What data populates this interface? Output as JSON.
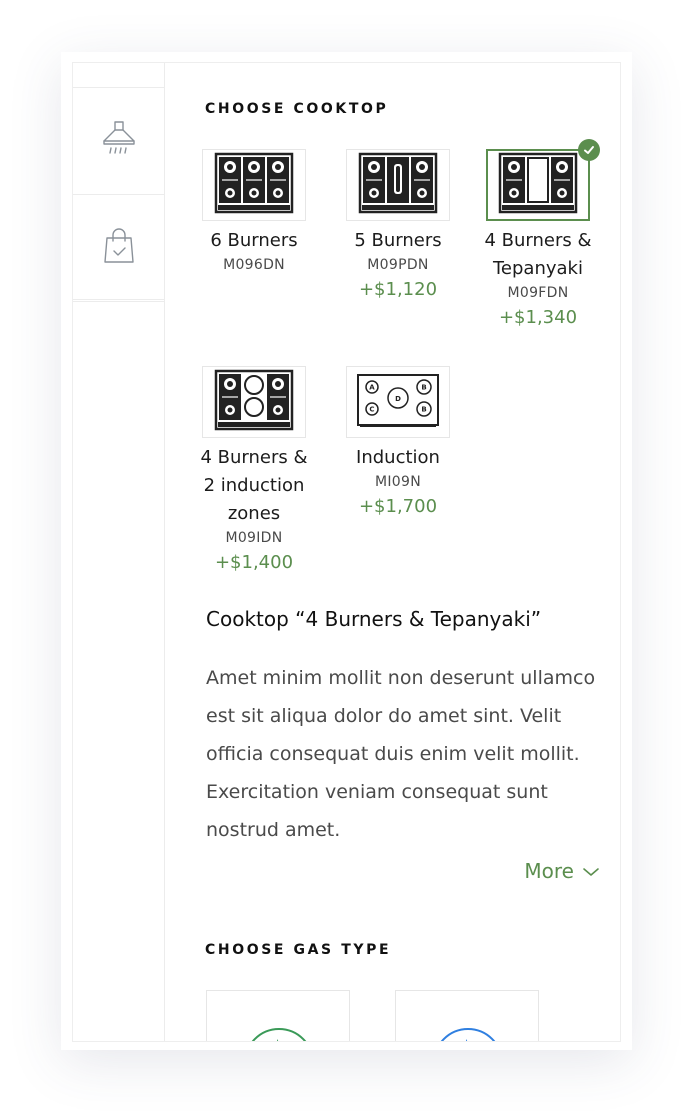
{
  "sidebar": {
    "items": [
      {
        "name": "hood",
        "icon": "range-hood-icon"
      },
      {
        "name": "bag",
        "icon": "shopping-bag-check-icon"
      }
    ]
  },
  "cooktop": {
    "title": "CHOOSE COOKTOP",
    "options": [
      {
        "name": "6 Burners",
        "code": "M096DN",
        "price": "",
        "selected": false,
        "icon": "six-burner-cooktop-icon"
      },
      {
        "name": "5 Burners",
        "code": "M09PDN",
        "price": "+$1,120",
        "selected": false,
        "icon": "five-burner-cooktop-icon"
      },
      {
        "name": "4 Burners & Tepanyaki",
        "code": "M09FDN",
        "price": "+$1,340",
        "selected": true,
        "icon": "tepanyaki-cooktop-icon"
      },
      {
        "name": "4 Burners & 2 induction zones",
        "code": "M09IDN",
        "price": "+$1,400",
        "selected": false,
        "icon": "induction-zones-cooktop-icon"
      },
      {
        "name": "Induction",
        "code": "MI09N",
        "price": "+$1,700",
        "selected": false,
        "icon": "induction-cooktop-icon"
      }
    ]
  },
  "description": {
    "title": "Cooktop “4 Burners & Tepanyaki”",
    "text": "Amet minim mollit non deserunt ullamco est sit aliqua dolor do amet sint. Velit officia consequat duis enim velit mollit. Exercitation veniam consequat sunt nostrud amet.",
    "more_label": "More"
  },
  "gas": {
    "title": "CHOOSE GAS TYPE",
    "options": [
      {
        "icon": "natural-gas-icon",
        "color": "#3a9a58"
      },
      {
        "icon": "propane-gas-icon",
        "color": "#2f7fe0"
      }
    ]
  },
  "colors": {
    "accent": "#5b8e4e",
    "text": "#1c1c1c",
    "muted": "#4a4a4a"
  }
}
